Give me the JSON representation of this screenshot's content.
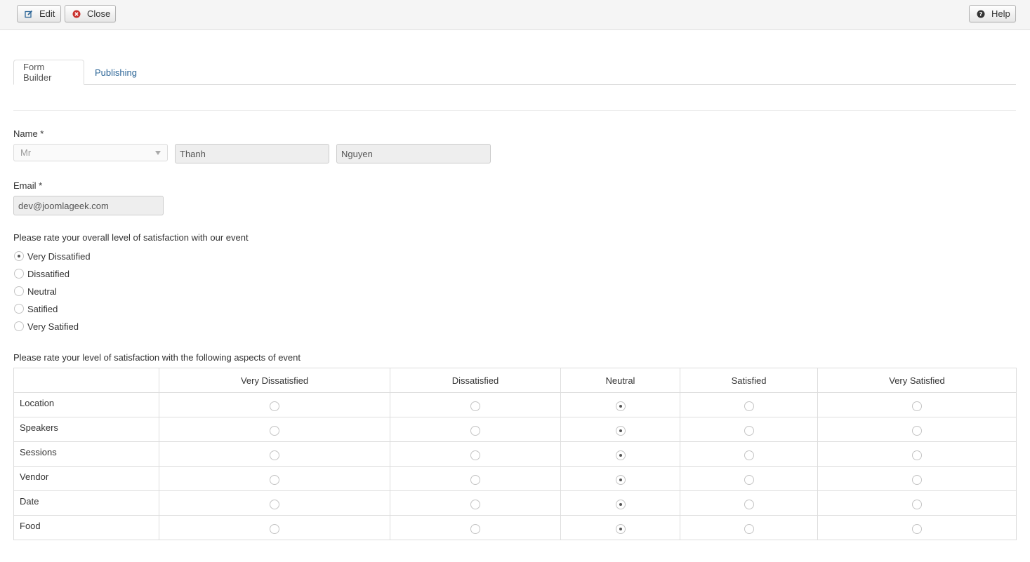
{
  "toolbar": {
    "edit_label": "Edit",
    "close_label": "Close",
    "help_label": "Help"
  },
  "tabs": [
    {
      "label": "Form Builder",
      "active": true
    },
    {
      "label": "Publishing",
      "active": false
    }
  ],
  "form": {
    "name": {
      "label": "Name *",
      "title_value": "Mr",
      "first_name": "Thanh",
      "last_name": "Nguyen"
    },
    "email": {
      "label": "Email *",
      "value": "dev@joomlageek.com"
    },
    "overall": {
      "question": "Please rate your overall level of satisfaction with our event",
      "options": [
        "Very Dissatified",
        "Dissatified",
        "Neutral",
        "Satified",
        "Very Satified"
      ],
      "selected_index": 0
    },
    "matrix": {
      "question": "Please rate your level of satisfaction with the following aspects of event",
      "columns": [
        "Very Dissatisfied",
        "Dissatisfied",
        "Neutral",
        "Satisfied",
        "Very Satisfied"
      ],
      "rows": [
        {
          "label": "Location",
          "selected_index": 2
        },
        {
          "label": "Speakers",
          "selected_index": 2
        },
        {
          "label": "Sessions",
          "selected_index": 2
        },
        {
          "label": "Vendor",
          "selected_index": 2
        },
        {
          "label": "Date",
          "selected_index": 2
        },
        {
          "label": "Food",
          "selected_index": 2
        }
      ]
    }
  },
  "icons": {
    "edit": "edit-icon",
    "close": "close-circle-icon",
    "help": "help-circle-icon"
  },
  "colors": {
    "close_icon": "#c9302c",
    "link": "#2a6496",
    "help_icon": "#333333"
  }
}
